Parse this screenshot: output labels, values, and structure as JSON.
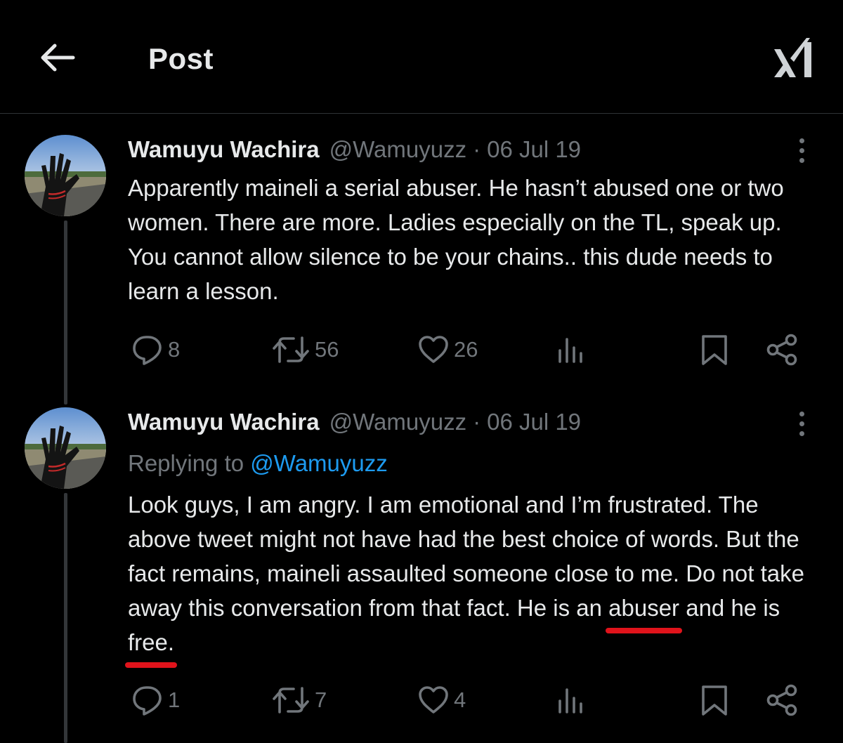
{
  "header": {
    "title": "Post"
  },
  "posts": [
    {
      "name": "Wamuyu Wachira",
      "handle": "@Wamuyuzz",
      "separator": "·",
      "date": "06 Jul 19",
      "text": "Apparently  maineli a serial abuser. He hasn’t abused one or two women. There are more. Ladies especially on the TL, speak up. You cannot allow silence to be your chains.. this dude needs to learn a lesson.",
      "replies": "8",
      "reposts": "56",
      "likes": "26"
    },
    {
      "name": "Wamuyu Wachira",
      "handle": "@Wamuyuzz",
      "separator": "·",
      "date": "06 Jul 19",
      "reply_prefix": "Replying to ",
      "reply_handle": "@Wamuyuzz",
      "text_part1": "Look guys, I am angry. I am emotional and I’m frustrated. The above tweet might not have had the best choice of words. But the fact remains, maineli assaulted someone close to me. Do not take away this conversation from that fact. He is an ",
      "text_mark1": "abuser",
      "text_part2": " and he is ",
      "text_mark2": "free.",
      "replies": "1",
      "reposts": "7",
      "likes": "4"
    }
  ],
  "icons": {
    "back": "arrow-left-icon",
    "logo": "xai-logo",
    "more": "more-vertical-icon",
    "reply": "reply-icon",
    "repost": "repost-icon",
    "like": "heart-icon",
    "views": "views-icon",
    "bookmark": "bookmark-icon",
    "share": "share-icon"
  },
  "colors": {
    "background": "#000000",
    "text": "#e7e9ea",
    "secondary": "#71767b",
    "link": "#1d9bf0",
    "annotation": "#e0131b"
  }
}
